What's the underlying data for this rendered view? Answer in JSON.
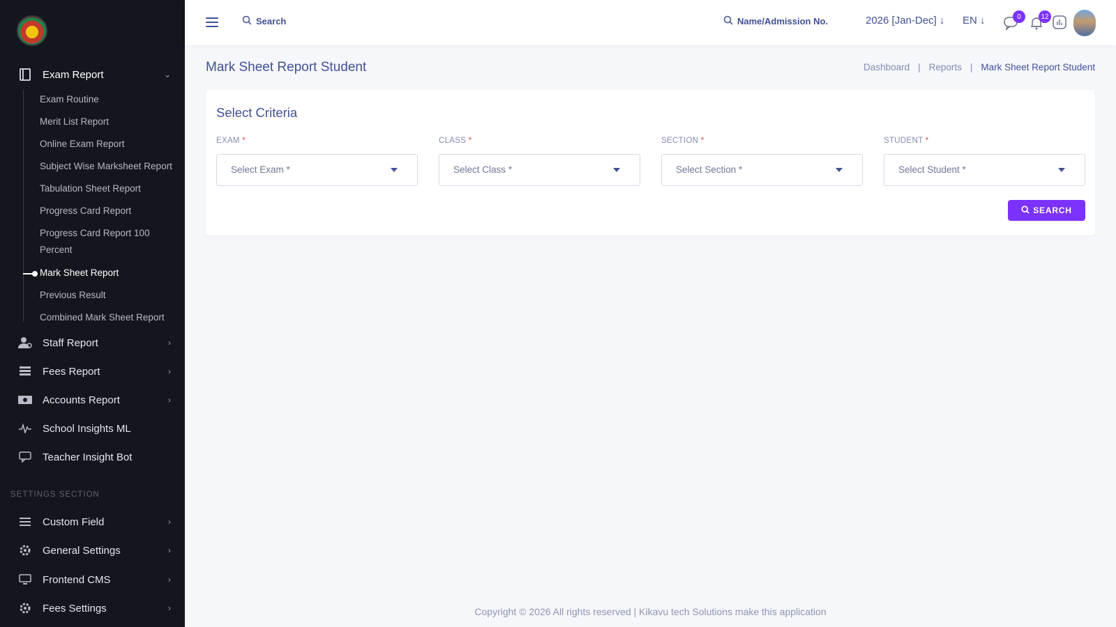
{
  "sidebar": {
    "exam_report": {
      "label": "Exam Report",
      "icon": "book-icon"
    },
    "exam_subitems": [
      "Exam Routine",
      "Merit List Report",
      "Online Exam Report",
      "Subject Wise Marksheet Report",
      "Tabulation Sheet Report",
      "Progress Card Report",
      "Progress Card Report 100",
      "Percent",
      "Mark Sheet Report",
      "Previous Result",
      "Combined Mark Sheet Report"
    ],
    "menus": [
      {
        "label": "Staff Report",
        "icon": "user-icon"
      },
      {
        "label": "Fees Report",
        "icon": "stack-icon"
      },
      {
        "label": "Accounts Report",
        "icon": "money-icon"
      },
      {
        "label": "School Insights ML",
        "icon": "pulse-icon"
      },
      {
        "label": "Teacher Insight Bot",
        "icon": "chat-icon"
      }
    ],
    "settings_title": "SETTINGS SECTION",
    "settings_menus": [
      {
        "label": "Custom Field",
        "icon": "list-icon"
      },
      {
        "label": "General Settings",
        "icon": "gear-icon"
      },
      {
        "label": "Frontend CMS",
        "icon": "monitor-icon"
      },
      {
        "label": "Fees Settings",
        "icon": "gear-icon"
      }
    ]
  },
  "topbar": {
    "search_label": "Search",
    "name_search_label": "Name/Admission No.",
    "year": "2026 [Jan-Dec]",
    "language": "EN",
    "messages_count": "0",
    "notifications_count": "12"
  },
  "page": {
    "title": "Mark Sheet Report Student",
    "breadcrumb": [
      "Dashboard",
      "Reports",
      "Mark Sheet Report Student"
    ]
  },
  "criteria": {
    "title": "Select Criteria",
    "fields": [
      {
        "label": "EXAM",
        "placeholder": "Select Exam *"
      },
      {
        "label": "CLASS",
        "placeholder": "Select Class *"
      },
      {
        "label": "SECTION",
        "placeholder": "Select Section *"
      },
      {
        "label": "STUDENT",
        "placeholder": "Select Student *"
      }
    ],
    "required_mark": "*",
    "search_button": "SEARCH"
  },
  "footer": {
    "text": "Copyright © 2026 All rights reserved | Kikavu tech Solutions make this application"
  },
  "colors": {
    "accent": "#7c32ff",
    "sidebar_bg": "#14161d",
    "text_primary": "#415094"
  }
}
